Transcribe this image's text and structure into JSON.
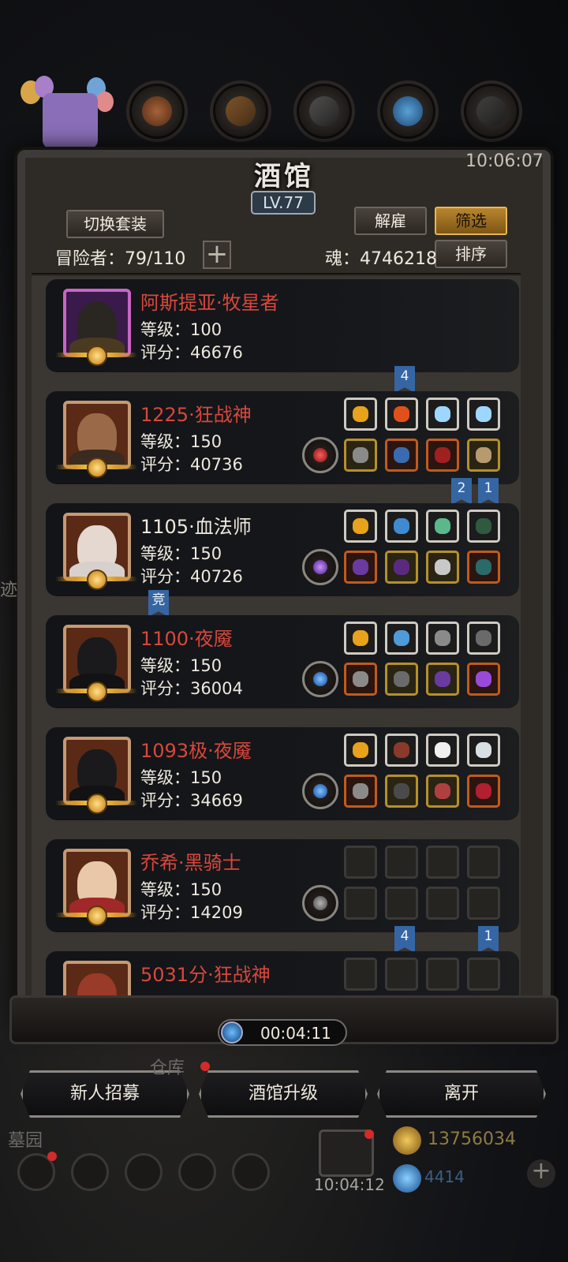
{
  "top_clock": "10:06:07",
  "tavern": {
    "title": "酒馆",
    "level": "LV.77",
    "switch_outfit": "切换套装",
    "dismiss": "解雇",
    "filter": "筛选",
    "sort": "排序",
    "adventurers_label": "冒险者：79/110",
    "soul_label": "魂：4746218",
    "plus": "+"
  },
  "heroes": [
    {
      "name": "阿斯提亚·牧星者",
      "name_color": "red",
      "level": "等级：100",
      "score": "评分：46676",
      "emblem": null,
      "portrait": "hooded-figure",
      "rank_badges": []
    },
    {
      "name": "1225·狂战神",
      "name_color": "red",
      "level": "等级：150",
      "score": "评分：40736",
      "emblem": "red-demon",
      "portrait": "berserker",
      "rank_badges": [
        "4"
      ]
    },
    {
      "name": "1105·血法师",
      "name_color": "white",
      "level": "等级：150",
      "score": "评分：40726",
      "emblem": "purple-demon",
      "portrait": "white-haired-mage",
      "rank_badges": [
        "2",
        "1"
      ]
    },
    {
      "name": "1100·夜魇",
      "name_color": "red",
      "level": "等级：150",
      "score": "评分：36004",
      "emblem": "blue-eye",
      "portrait": "dark-knight",
      "rank_badges": [
        "竞"
      ]
    },
    {
      "name": "1093极·夜魇",
      "name_color": "red",
      "level": "等级：150",
      "score": "评分：34669",
      "emblem": "blue-eye",
      "portrait": "dark-knight",
      "rank_badges": []
    },
    {
      "name": "乔希·黑骑士",
      "name_color": "red",
      "level": "等级：150",
      "score": "评分：14209",
      "emblem": "empty-sword",
      "portrait": "blonde-woman",
      "rank_badges": []
    },
    {
      "name": "5031分·狂战神",
      "name_color": "red",
      "level": "",
      "score": "",
      "emblem": null,
      "portrait": "berserker",
      "rank_badges": [
        "4",
        "1"
      ]
    }
  ],
  "timer": "00:04:11",
  "actions": {
    "recruit": "新人招募",
    "upgrade": "酒馆升级",
    "leave": "离开"
  },
  "background": {
    "warehouse_label": "仓库",
    "cemetery_label": "墓园",
    "gift_time": "10:04:12",
    "gold": "13756034",
    "gems": "4414",
    "side_text": "迹"
  },
  "colors": {
    "name_red": "#d9473b",
    "filter_gold": "#b9862e",
    "ribbon_blue": "#3566a3",
    "slot_gold": "#b6902b",
    "slot_orange": "#c25a1d"
  }
}
